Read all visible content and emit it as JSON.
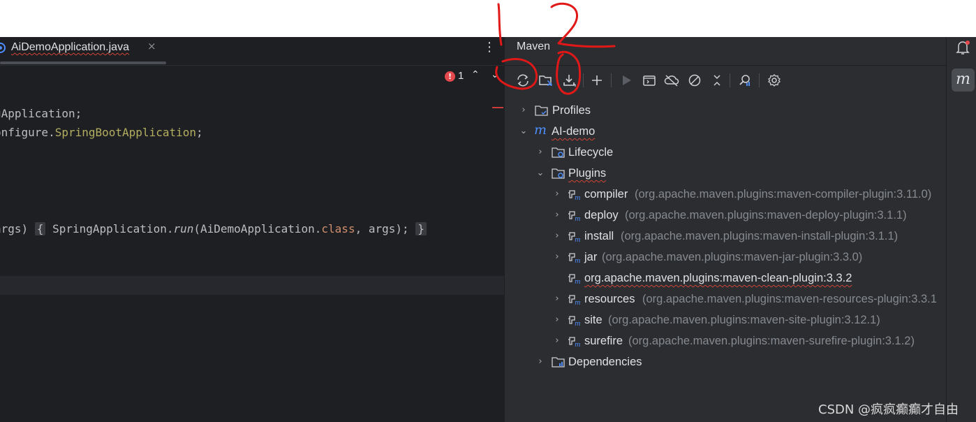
{
  "editor": {
    "tab_label": "AiDemoApplication.java",
    "tab_close": "×",
    "more": "⋮",
    "error_count": "1",
    "error_glyph": "!",
    "nav_up": "⌃",
    "nav_down": "⌄",
    "code": {
      "l1": "gApplication;",
      "l2_a": "onfigure.",
      "l2_b": "SpringBootApplication",
      "l2_c": ";",
      "l3_a": "args) ",
      "l3_b": "{",
      "l3_c": " SpringApplication.",
      "l3_d": "run",
      "l3_e": "(AiDemoApplication.",
      "l3_f": "class",
      "l3_g": ", args); ",
      "l3_h": "}"
    }
  },
  "maven": {
    "title": "Maven",
    "toolbar": [
      "reload-icon",
      "generate-sources-icon",
      "download-icon",
      "add-icon",
      "run-icon",
      "execute-goal-icon",
      "offline-icon",
      "skip-tests-icon",
      "collapse-all-icon",
      "analyze-dependencies-icon",
      "settings-icon"
    ],
    "tree": {
      "profiles": "Profiles",
      "project": "AI-demo",
      "lifecycle": "Lifecycle",
      "plugins": "Plugins",
      "plugin_items": [
        {
          "name": "compiler",
          "artifact": "(org.apache.maven.plugins:maven-compiler-plugin:3.11.0)"
        },
        {
          "name": "deploy",
          "artifact": "(org.apache.maven.plugins:maven-deploy-plugin:3.1.1)"
        },
        {
          "name": "install",
          "artifact": "(org.apache.maven.plugins:maven-install-plugin:3.1.1)"
        },
        {
          "name": "jar",
          "artifact": "(org.apache.maven.plugins:maven-jar-plugin:3.3.0)"
        },
        {
          "name": "org.apache.maven.plugins:maven-clean-plugin:3.3.2",
          "artifact": ""
        },
        {
          "name": "resources",
          "artifact": "(org.apache.maven.plugins:maven-resources-plugin:3.3.1"
        },
        {
          "name": "site",
          "artifact": "(org.apache.maven.plugins:maven-site-plugin:3.12.1)"
        },
        {
          "name": "surefire",
          "artifact": "(org.apache.maven.plugins:maven-surefire-plugin:3.1.2)"
        }
      ],
      "dependencies": "Dependencies"
    }
  },
  "strip": {
    "maven_glyph": "m"
  },
  "colors": {
    "annotation_red": "#e01818",
    "editor_bg": "#1e1f22",
    "panel_bg": "#2b2d30",
    "accent_blue": "#4e8eff"
  },
  "watermark": "CSDN @疯疯癫癫才自由"
}
